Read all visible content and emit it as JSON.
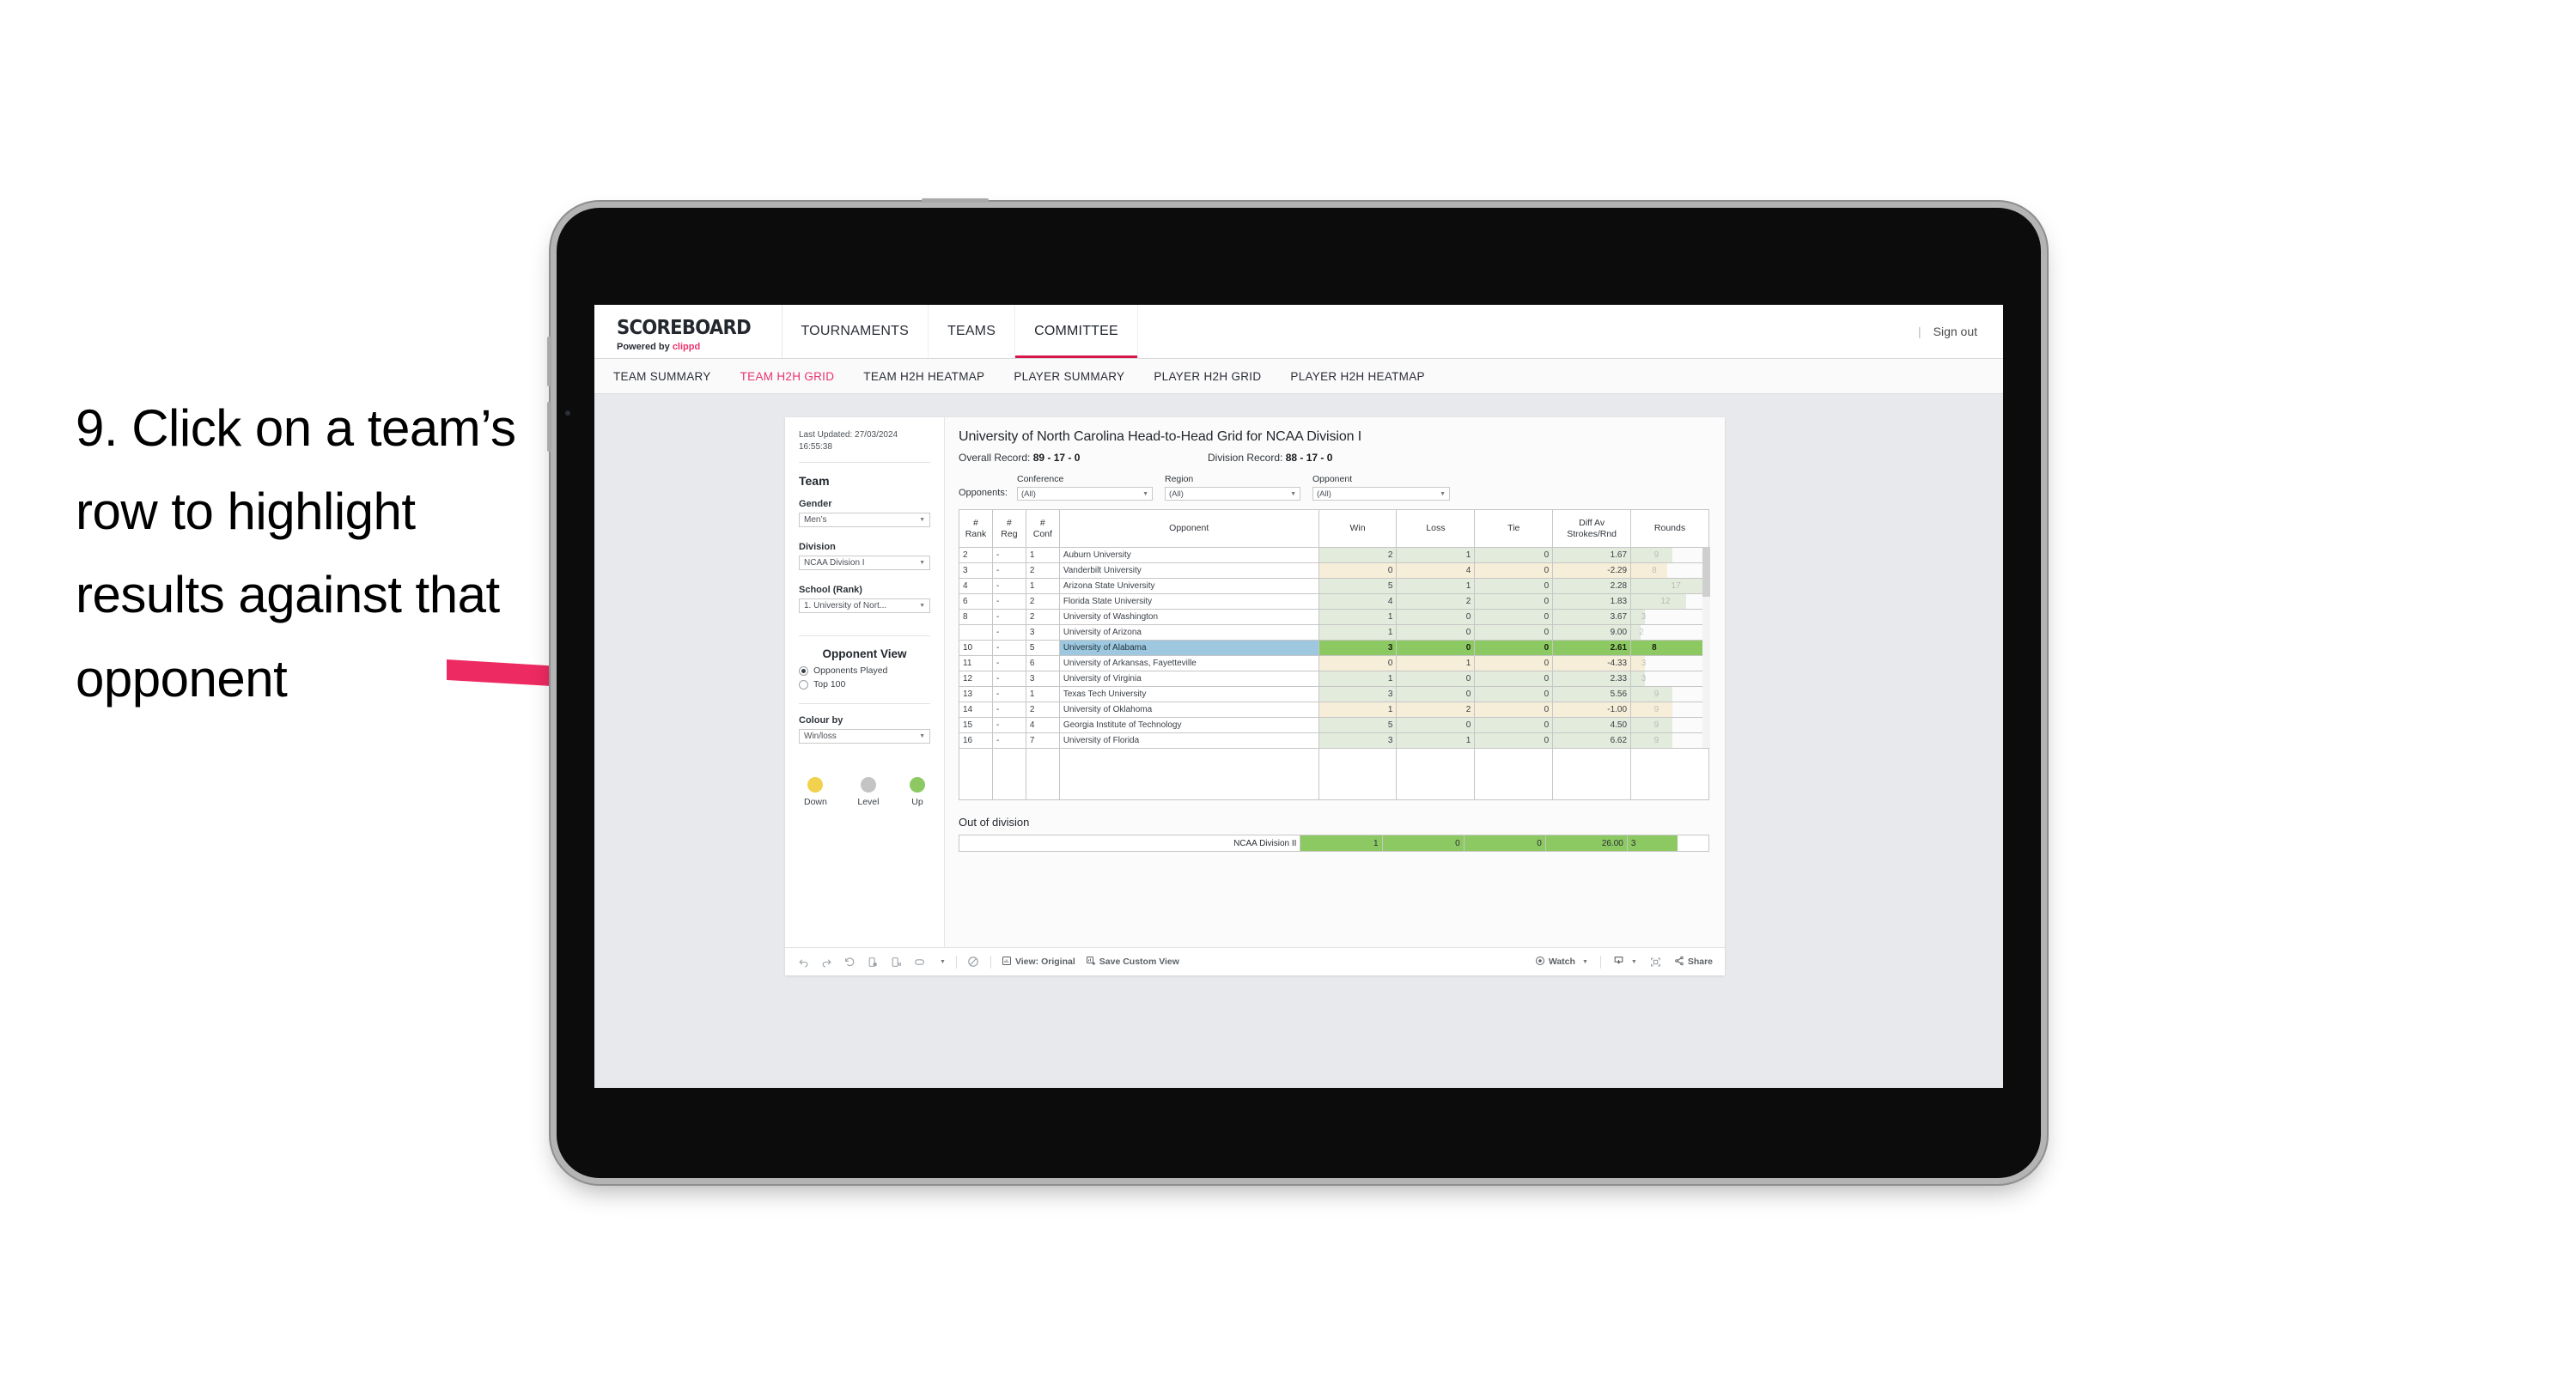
{
  "annotation": {
    "text": "9. Click on a team’s row to highlight results against that opponent"
  },
  "app": {
    "brand": {
      "title": "SCOREBOARD",
      "powered_prefix": "Powered by",
      "powered_brand": "clippd"
    },
    "nav": [
      {
        "label": "TOURNAMENTS",
        "active": false
      },
      {
        "label": "TEAMS",
        "active": false
      },
      {
        "label": "COMMITTEE",
        "active": true
      }
    ],
    "sign_out": "Sign out",
    "divider": "|",
    "subnav": [
      {
        "label": "TEAM SUMMARY",
        "active": false
      },
      {
        "label": "TEAM H2H GRID",
        "active": true
      },
      {
        "label": "TEAM H2H HEATMAP",
        "active": false
      },
      {
        "label": "PLAYER SUMMARY",
        "active": false
      },
      {
        "label": "PLAYER H2H GRID",
        "active": false
      },
      {
        "label": "PLAYER H2H HEATMAP",
        "active": false
      }
    ]
  },
  "filters": {
    "last_updated": "Last Updated: 27/03/2024 16:55:38",
    "team_heading": "Team",
    "gender_label": "Gender",
    "gender_value": "Men’s",
    "division_label": "Division",
    "division_value": "NCAA Division I",
    "school_label": "School (Rank)",
    "school_value": "1. University of Nort...",
    "opponent_view_heading": "Opponent View",
    "opponent_view_options": [
      {
        "label": "Opponents Played",
        "selected": true
      },
      {
        "label": "Top 100",
        "selected": false
      }
    ],
    "colour_by_label": "Colour by",
    "colour_by_value": "Win/loss",
    "legend": [
      {
        "label": "Down",
        "color": "#F2D14E"
      },
      {
        "label": "Level",
        "color": "#C4C4C4"
      },
      {
        "label": "Up",
        "color": "#8DC963"
      }
    ]
  },
  "viz": {
    "title": "University of North Carolina Head-to-Head Grid for NCAA Division I",
    "overall_record_label": "Overall Record:",
    "overall_record_value": "89 - 17 - 0",
    "division_record_label": "Division Record:",
    "division_record_value": "88 - 17 - 0",
    "opponents_label": "Opponents:",
    "dropdowns": [
      {
        "label": "Conference",
        "value": "(All)"
      },
      {
        "label": "Region",
        "value": "(All)"
      },
      {
        "label": "Opponent",
        "value": "(All)"
      }
    ],
    "out_of_division_title": "Out of division"
  },
  "chart_data": {
    "type": "table",
    "title": "University of North Carolina Head-to-Head Grid for NCAA Division I",
    "columns": [
      "# Rank",
      "# Reg",
      "# Conf",
      "Opponent",
      "Win",
      "Loss",
      "Tie",
      "Diff Av Strokes/Rnd",
      "Rounds"
    ],
    "rows": [
      {
        "rank": "2",
        "reg": "-",
        "conf": "1",
        "opponent": "Auburn University",
        "win": "2",
        "loss": "1",
        "tie": "0",
        "diff": "1.67",
        "rounds": "9",
        "fill": "green",
        "highlight": false
      },
      {
        "rank": "3",
        "reg": "-",
        "conf": "2",
        "opponent": "Vanderbilt University",
        "win": "0",
        "loss": "4",
        "tie": "0",
        "diff": "-2.29",
        "rounds": "8",
        "fill": "yellow",
        "highlight": false
      },
      {
        "rank": "4",
        "reg": "-",
        "conf": "1",
        "opponent": "Arizona State University",
        "win": "5",
        "loss": "1",
        "tie": "0",
        "diff": "2.28",
        "rounds": "17",
        "fill": "green",
        "highlight": false
      },
      {
        "rank": "6",
        "reg": "-",
        "conf": "2",
        "opponent": "Florida State University",
        "win": "4",
        "loss": "2",
        "tie": "0",
        "diff": "1.83",
        "rounds": "12",
        "fill": "green",
        "highlight": false
      },
      {
        "rank": "8",
        "reg": "-",
        "conf": "2",
        "opponent": "University of Washington",
        "win": "1",
        "loss": "0",
        "tie": "0",
        "diff": "3.67",
        "rounds": "3",
        "fill": "green",
        "highlight": false
      },
      {
        "rank": "",
        "reg": "-",
        "conf": "3",
        "opponent": "University of Arizona",
        "win": "1",
        "loss": "0",
        "tie": "0",
        "diff": "9.00",
        "rounds": "2",
        "fill": "green",
        "highlight": false
      },
      {
        "rank": "10",
        "reg": "-",
        "conf": "5",
        "opponent": "University of Alabama",
        "win": "3",
        "loss": "0",
        "tie": "0",
        "diff": "2.61",
        "rounds": "8",
        "fill": "green",
        "highlight": true
      },
      {
        "rank": "11",
        "reg": "-",
        "conf": "6",
        "opponent": "University of Arkansas, Fayetteville",
        "win": "0",
        "loss": "1",
        "tie": "0",
        "diff": "-4.33",
        "rounds": "3",
        "fill": "yellow",
        "highlight": false
      },
      {
        "rank": "12",
        "reg": "-",
        "conf": "3",
        "opponent": "University of Virginia",
        "win": "1",
        "loss": "0",
        "tie": "0",
        "diff": "2.33",
        "rounds": "3",
        "fill": "green",
        "highlight": false
      },
      {
        "rank": "13",
        "reg": "-",
        "conf": "1",
        "opponent": "Texas Tech University",
        "win": "3",
        "loss": "0",
        "tie": "0",
        "diff": "5.56",
        "rounds": "9",
        "fill": "green",
        "highlight": false
      },
      {
        "rank": "14",
        "reg": "-",
        "conf": "2",
        "opponent": "University of Oklahoma",
        "win": "1",
        "loss": "2",
        "tie": "0",
        "diff": "-1.00",
        "rounds": "9",
        "fill": "yellow",
        "highlight": false
      },
      {
        "rank": "15",
        "reg": "-",
        "conf": "4",
        "opponent": "Georgia Institute of Technology",
        "win": "5",
        "loss": "0",
        "tie": "0",
        "diff": "4.50",
        "rounds": "9",
        "fill": "green",
        "highlight": false
      },
      {
        "rank": "16",
        "reg": "-",
        "conf": "7",
        "opponent": "University of Florida",
        "win": "3",
        "loss": "1",
        "tie": "0",
        "diff": "6.62",
        "rounds": "9",
        "fill": "green",
        "highlight": false
      }
    ],
    "out_of_division": {
      "label": "NCAA Division II",
      "win": "1",
      "loss": "0",
      "tie": "0",
      "diff": "26.00",
      "rounds": "3"
    },
    "colors": {
      "green_light": "#e3ebdd",
      "yellow_light": "#f6eed8",
      "green_strong": "#8dc963",
      "highlight_blue": "#9dc8df",
      "accent": "#e8336d"
    }
  },
  "toolbar": {
    "view_label": "View: Original",
    "save_label": "Save Custom View",
    "watch_label": "Watch",
    "share_label": "Share",
    "caret": "▾",
    "icons": [
      "undo-icon",
      "redo-icon",
      "revert-icon",
      "refresh-data-icon",
      "pause-auto-update-icon",
      "device-layout-icon",
      "clear-sheet-icon"
    ]
  }
}
